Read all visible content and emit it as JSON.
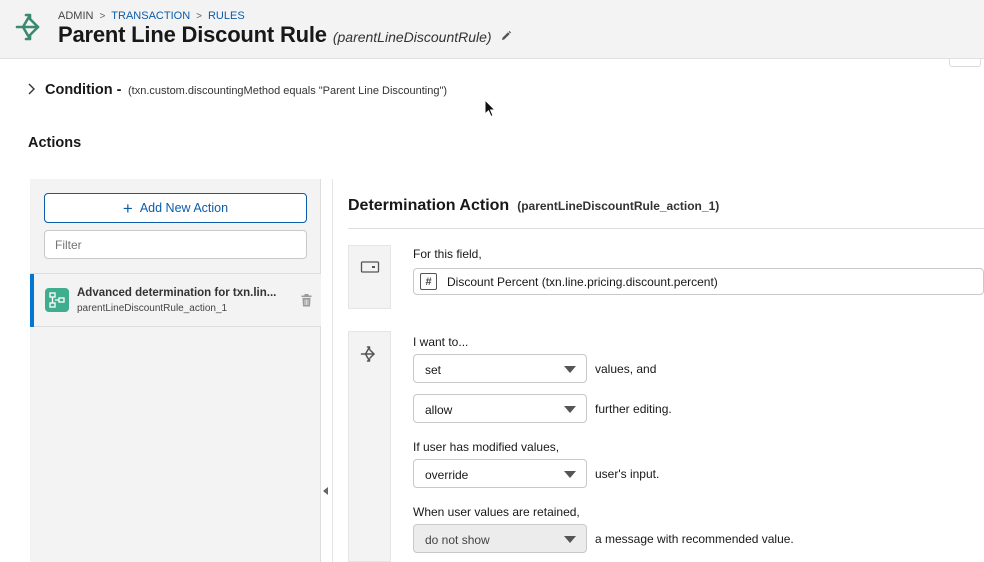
{
  "header": {
    "breadcrumb": [
      "ADMIN",
      "TRANSACTION",
      "RULES"
    ],
    "breadcrumb_sep": ">",
    "title": "Parent Line Discount Rule",
    "api_name": "(parentLineDiscountRule)",
    "icon": "share-branch-icon"
  },
  "condition": {
    "label": "Condition -",
    "expression": "(txn.custom.discountingMethod equals \"Parent Line Discounting\")"
  },
  "actions": {
    "title": "Actions",
    "add_button_label": "Add New Action",
    "filter_placeholder": "Filter",
    "items": [
      {
        "title": "Advanced determination for txn.lin...",
        "subtitle": "parentLineDiscountRule_action_1",
        "icon": "flow-icon"
      }
    ]
  },
  "determination": {
    "title": "Determination Action",
    "api_name": "(parentLineDiscountRule_action_1)",
    "field_label": "For this field,",
    "field_value": "Discount Percent (txn.line.pricing.discount.percent)",
    "field_type_icon": "#",
    "want_label": "I want to...",
    "action_select": "set",
    "action_after": "values, and",
    "editing_select": "allow",
    "editing_after": "further editing.",
    "modified_label": "If user has modified values,",
    "modified_select": "override",
    "modified_after": "user's input.",
    "retained_label": "When user values are retained,",
    "retained_select": "do not show",
    "retained_after": "a message with recommended value."
  },
  "colors": {
    "accent": "#0176d3",
    "link": "#0b5cab",
    "header_icon": "#3a8a6e",
    "item_icon": "#3fae8f"
  }
}
